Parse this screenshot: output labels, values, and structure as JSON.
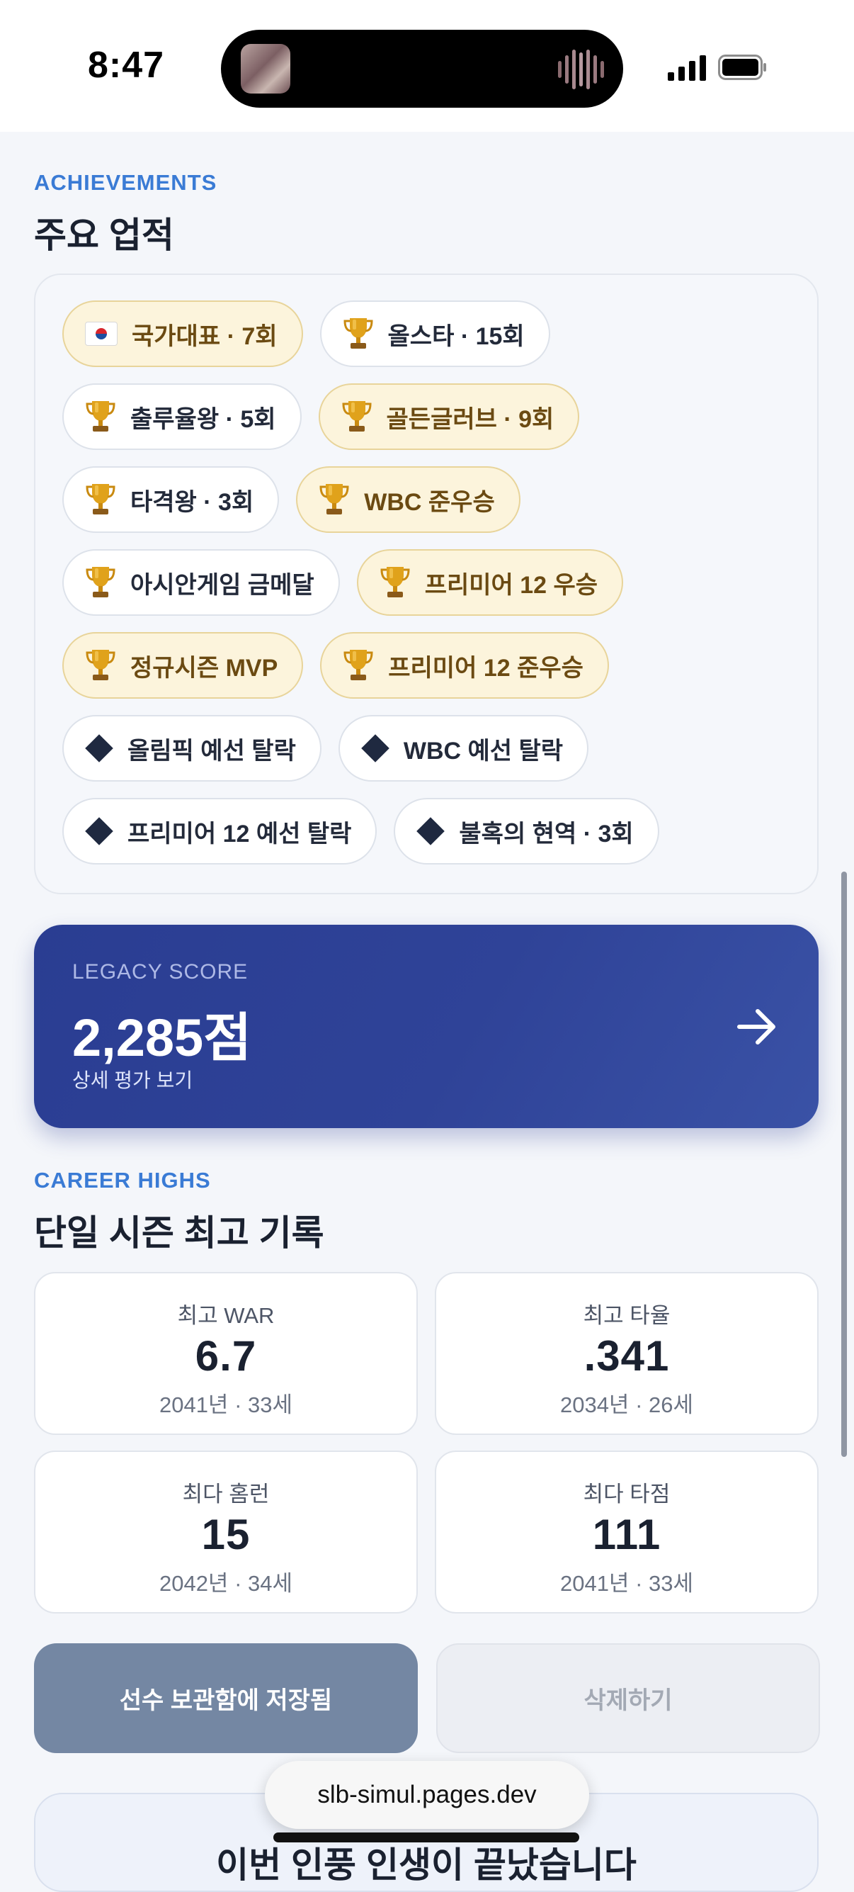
{
  "status_bar": {
    "time": "8:47"
  },
  "achievements": {
    "eyebrow": "ACHIEVEMENTS",
    "title": "주요 업적",
    "rows": [
      [
        {
          "label": "국가대표 · 7회",
          "icon": "flag-icon",
          "style": "gold"
        },
        {
          "label": "올스타 · 15회",
          "icon": "trophy-icon",
          "style": "plain"
        }
      ],
      [
        {
          "label": "출루율왕 · 5회",
          "icon": "trophy-icon",
          "style": "plain"
        },
        {
          "label": "골든글러브 · 9회",
          "icon": "trophy-icon",
          "style": "gold"
        }
      ],
      [
        {
          "label": "타격왕 · 3회",
          "icon": "trophy-icon",
          "style": "plain"
        },
        {
          "label": "WBC 준우승",
          "icon": "trophy-icon",
          "style": "gold"
        }
      ],
      [
        {
          "label": "아시안게임 금메달",
          "icon": "trophy-icon",
          "style": "plain"
        },
        {
          "label": "프리미어 12 우승",
          "icon": "trophy-icon",
          "style": "gold"
        }
      ],
      [
        {
          "label": "정규시즌 MVP",
          "icon": "trophy-icon",
          "style": "gold"
        },
        {
          "label": "프리미어 12 준우승",
          "icon": "trophy-icon",
          "style": "gold"
        }
      ],
      [
        {
          "label": "올림픽 예선 탈락",
          "icon": "diamond-icon",
          "style": "plain"
        },
        {
          "label": "WBC 예선 탈락",
          "icon": "diamond-icon",
          "style": "plain"
        }
      ],
      [
        {
          "label": "프리미어 12 예선 탈락",
          "icon": "diamond-icon",
          "style": "plain"
        },
        {
          "label": "불혹의 현역 · 3회",
          "icon": "diamond-icon",
          "style": "plain"
        }
      ]
    ]
  },
  "legacy": {
    "eyebrow": "LEGACY SCORE",
    "score": "2,285점",
    "link": "상세 평가 보기"
  },
  "career_highs": {
    "eyebrow": "CAREER HIGHS",
    "title": "단일 시즌 최고 기록",
    "stats": [
      {
        "label": "최고 WAR",
        "value": "6.7",
        "sub": "2041년 · 33세"
      },
      {
        "label": "최고 타율",
        "value": ".341",
        "sub": "2034년 · 26세"
      },
      {
        "label": "최다 홈런",
        "value": "15",
        "sub": "2042년 · 34세"
      },
      {
        "label": "최다 타점",
        "value": "111",
        "sub": "2041년 · 33세"
      }
    ]
  },
  "actions": {
    "saved_label": "선수 보관함에 저장됨",
    "delete_label": "삭제하기"
  },
  "browser": {
    "url": "slb-simul.pages.dev"
  },
  "bottom_card": {
    "text": "이번 인풍 인생이 끝났습니다"
  },
  "colors": {
    "accent": "#3a7bd5",
    "legacy_bg": "#2f4398",
    "gold_chip": "#fcf4dc"
  }
}
